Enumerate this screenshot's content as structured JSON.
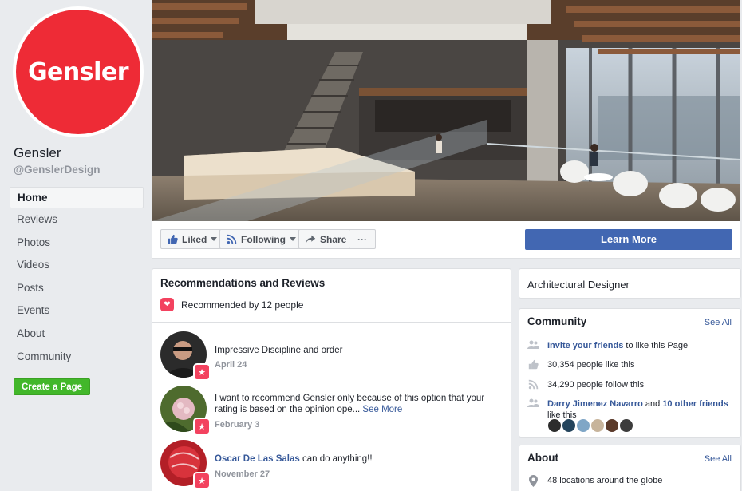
{
  "sidebar": {
    "logo_text": "Gensler",
    "page_name": "Gensler",
    "handle": "@GenslerDesign",
    "items": [
      {
        "label": "Home",
        "active": true
      },
      {
        "label": "Reviews"
      },
      {
        "label": "Photos"
      },
      {
        "label": "Videos"
      },
      {
        "label": "Posts"
      },
      {
        "label": "Events"
      },
      {
        "label": "About"
      },
      {
        "label": "Community"
      }
    ],
    "create_page": "Create a Page"
  },
  "actions": {
    "liked": "Liked",
    "following": "Following",
    "share": "Share",
    "more": "···",
    "learn_more": "Learn More"
  },
  "reviews": {
    "title": "Recommendations and Reviews",
    "recommended": "Recommended by 12 people",
    "items": [
      {
        "text": "Impressive Discipline and order",
        "date": "April 24"
      },
      {
        "text": "I want to recommend Gensler only because of this option that your rating is based on the opinion ope...",
        "see_more": "See More",
        "date": "February 3"
      },
      {
        "author": "Oscar De Las Salas",
        "text": " can do anything!!",
        "date": "November 27"
      }
    ]
  },
  "category": "Architectural Designer",
  "community": {
    "title": "Community",
    "see_all": "See All",
    "invite_link": "Invite your friends",
    "invite_rest": " to like this Page",
    "likes": "30,354 people like this",
    "follows": "34,290 people follow this",
    "friend_name": "Darry Jimenez Navarro",
    "friend_and": " and ",
    "friend_others": "10 other friends",
    "friend_rest": "like this"
  },
  "about": {
    "title": "About",
    "see_all": "See All",
    "locations": "48 locations around the globe"
  },
  "colors": {
    "brand_red": "#ee2b36",
    "fb_blue": "#4267b2",
    "green": "#42b72a",
    "link": "#365899",
    "badge_pink": "#f3425f"
  }
}
